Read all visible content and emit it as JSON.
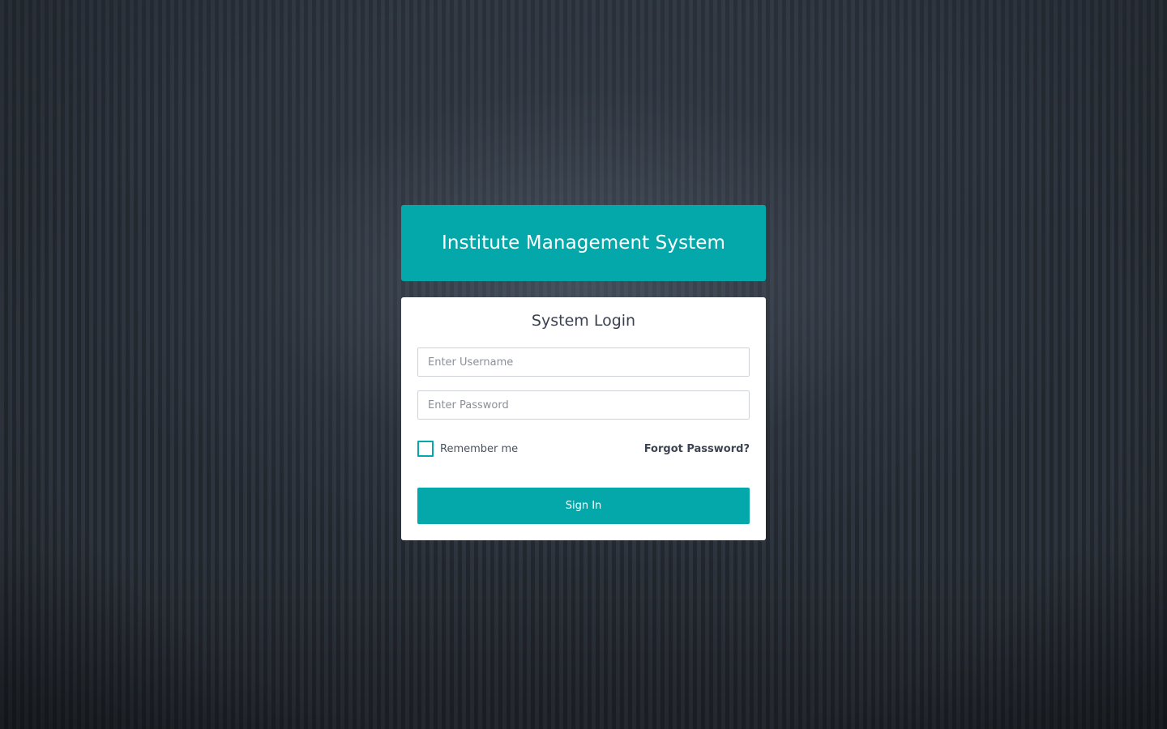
{
  "header": {
    "title": "Institute Management System"
  },
  "login": {
    "title": "System Login",
    "username": {
      "placeholder": "Enter Username",
      "value": ""
    },
    "password": {
      "placeholder": "Enter Password",
      "value": ""
    },
    "remember_label": "Remember me",
    "remember_checked": false,
    "forgot_label": "Forgot Password?",
    "signin_label": "Sign In"
  },
  "colors": {
    "accent": "#04a8aa",
    "background": "#2a3039",
    "card": "#ffffff",
    "text": "#3a4250"
  }
}
